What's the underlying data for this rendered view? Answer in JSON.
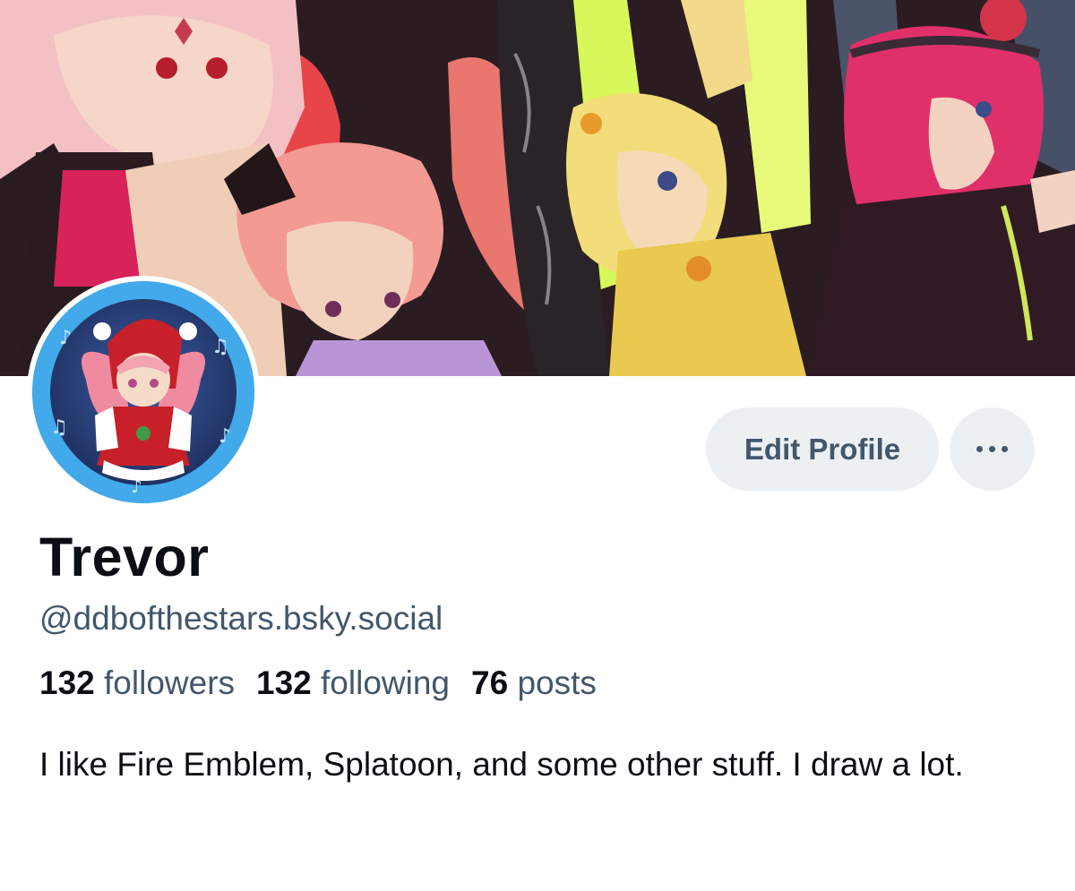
{
  "profile": {
    "display_name": "Trevor",
    "handle": "@ddbofthestars.bsky.social",
    "bio": "I like Fire Emblem, Splatoon, and some other stuff.  I draw a lot."
  },
  "stats": {
    "followers_count": "132",
    "followers_label": "followers",
    "following_count": "132",
    "following_label": "following",
    "posts_count": "76",
    "posts_label": "posts"
  },
  "actions": {
    "edit_profile_label": "Edit Profile",
    "more_icon": "ellipsis-icon"
  },
  "colors": {
    "primary_text": "#0b0f14",
    "secondary_text": "#42576c",
    "button_bg": "#edf0f3"
  }
}
